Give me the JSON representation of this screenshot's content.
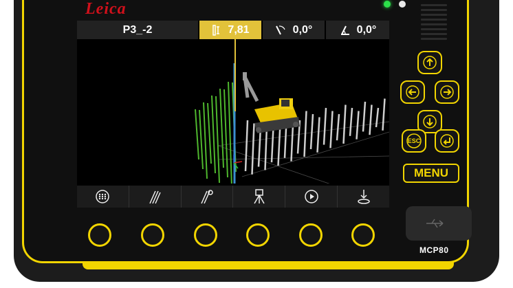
{
  "brand": {
    "logo_text": "Leica"
  },
  "status_bar": {
    "design_name": "P3_-2",
    "depth_value": "7,81",
    "angle1_value": "0,0°",
    "angle2_value": "0,0°"
  },
  "toolbar": {
    "icons": [
      "menu-grid-icon",
      "pile-icon",
      "pile-target-icon",
      "total-station-icon",
      "play-icon",
      "stakeout-icon"
    ]
  },
  "nav_keys": [
    "arrow-up-icon",
    "arrow-left-icon",
    "arrow-right-icon",
    "arrow-down-icon",
    "esc-icon",
    "enter-icon"
  ],
  "keys": {
    "esc_label": "ESC",
    "menu_label": "MENU"
  },
  "device": {
    "model": "MCP80"
  },
  "colors": {
    "accent": "#f2d500",
    "brand_red": "#d0101b",
    "led_green": "#2ce04a",
    "depth_cell": "#e2c23a"
  }
}
